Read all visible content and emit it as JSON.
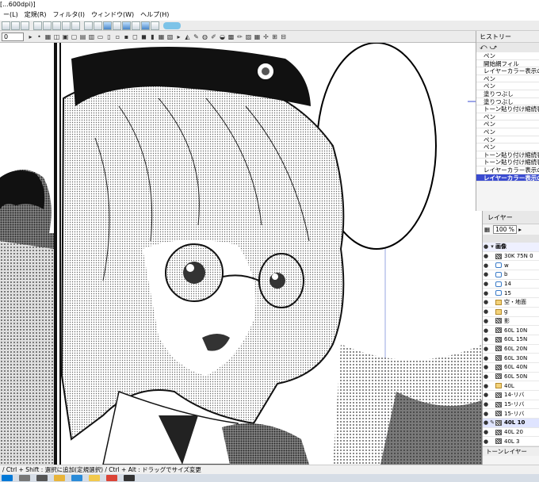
{
  "window": {
    "title": "[...600dpi)]"
  },
  "menu": [
    "ー(L)",
    "定規(R)",
    "フィルタ(I)",
    "ウィンドウ(W)",
    "ヘルプ(H)"
  ],
  "toolbar": {
    "size_value": "0"
  },
  "history_panel": {
    "title": "ヒストリー",
    "undo_icons": "⤺ ⤻",
    "items": [
      "ペン",
      "開始網フィル",
      "レイヤーカラー表示の切り替え",
      "ペン",
      "ペン",
      "塗りつぶし",
      "塗りつぶし",
      "トーン貼り付け縮続表示の切",
      "ペン",
      "ペン",
      "ペン",
      "ペン",
      "ペン",
      "トーン貼り付け縮続表示の切",
      "トーン貼り付け縮続表示の切",
      "レイヤーカラー表示の切り替え",
      "レイヤーカラー表示の切り"
    ],
    "selected_index": 16
  },
  "layer_panel": {
    "title": "レイヤー",
    "opacity": "100 %",
    "root": "画像",
    "layers": [
      {
        "name": "30K 75N 0",
        "icon": "tone"
      },
      {
        "name": "w",
        "icon": "plain"
      },
      {
        "name": "b",
        "icon": "plain"
      },
      {
        "name": "14",
        "icon": "plain"
      },
      {
        "name": "15",
        "icon": "plain"
      },
      {
        "name": "空・地面",
        "icon": "folder"
      },
      {
        "name": "g",
        "icon": "folder"
      },
      {
        "name": "影",
        "icon": "tone"
      },
      {
        "name": "60L 10N",
        "icon": "tone"
      },
      {
        "name": "60L 15N",
        "icon": "tone"
      },
      {
        "name": "60L 20N",
        "icon": "tone"
      },
      {
        "name": "60L 30N",
        "icon": "tone"
      },
      {
        "name": "60L 40N",
        "icon": "tone"
      },
      {
        "name": "60L 50N",
        "icon": "tone"
      },
      {
        "name": "40L",
        "icon": "folder"
      },
      {
        "name": "14-リバ",
        "icon": "tone"
      },
      {
        "name": "15-リバ",
        "icon": "tone"
      },
      {
        "name": "15-リバ",
        "icon": "tone"
      },
      {
        "name": "40L 10",
        "icon": "tone"
      },
      {
        "name": "40L 20",
        "icon": "tone"
      },
      {
        "name": "40L 3",
        "icon": "tone"
      }
    ],
    "selected_index": 18,
    "footer": "トーンレイヤー"
  },
  "status_bar": {
    "text": "/ Ctrl + Shift : 選択に追加(定規選択) / Ctrl + Alt : ドラッグでサイズ変更"
  },
  "taskbar_icons": [
    "start",
    "search",
    "task-view",
    "explorer",
    "edge",
    "file-manager",
    "chrome",
    "app"
  ]
}
